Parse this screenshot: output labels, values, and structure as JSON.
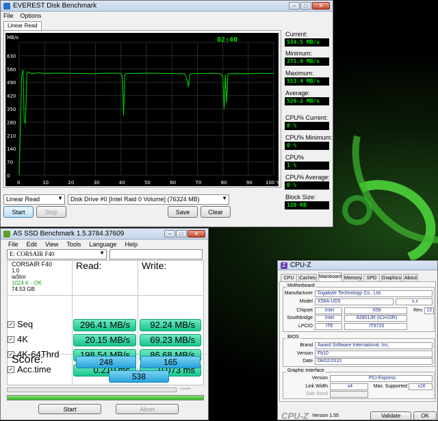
{
  "everest": {
    "title": "EVEREST Disk Benchmark",
    "menu": [
      "File",
      "Options"
    ],
    "tab": "Linear Read",
    "timer": "02:40",
    "y_unit": "MB/s",
    "side": [
      {
        "label": "Current:",
        "value": "534.5 MB/s"
      },
      {
        "label": "Minimum:",
        "value": "271.9 MB/s"
      },
      {
        "label": "Maximum:",
        "value": "553.4 MB/s"
      },
      {
        "label": "Average:",
        "value": "526.2 MB/s"
      },
      {
        "label": "CPU% Current:",
        "value": "0 %"
      },
      {
        "label": "CPU% Minimum:",
        "value": "0 %"
      },
      {
        "label": "CPU% Maximum:",
        "value": "1 %"
      },
      {
        "label": "CPU% Average:",
        "value": "0 %"
      },
      {
        "label": "Block Size:",
        "value": "128 KB"
      }
    ],
    "test_select": "Linear Read",
    "drive_select": "Disk Drive #0  [Intel  Raid 0 Volume]  (76324 MB)",
    "buttons": {
      "start": "Start",
      "stop": "Stop",
      "save": "Save",
      "clear": "Clear"
    },
    "colors": {
      "plot_bg": "#000000",
      "line": "#00c000",
      "grid": "#2a2a2a"
    }
  },
  "chart_data": {
    "type": "line",
    "x_unit": "%",
    "ylabel": "MB/s",
    "xlim": [
      0,
      100
    ],
    "ylim": [
      0,
      700
    ],
    "x_ticks": [
      "0",
      "10",
      "20",
      "30",
      "40",
      "50",
      "60",
      "70",
      "80",
      "90",
      "100 %"
    ],
    "y_ticks": [
      "700",
      "630",
      "560",
      "490",
      "420",
      "350",
      "280",
      "210",
      "140",
      "70",
      "0"
    ],
    "series": [
      {
        "x": [
          0,
          1,
          1.5,
          2,
          2.5,
          3,
          3.5,
          4,
          5,
          6,
          8,
          10,
          15,
          20,
          25,
          30,
          35,
          40,
          40.5,
          41,
          41.5,
          42,
          45,
          50,
          55,
          60,
          65,
          66,
          66.5,
          67,
          67.5,
          68,
          70,
          75,
          79,
          80,
          80.5,
          81,
          81.5,
          82,
          85,
          90,
          95,
          100
        ],
        "y": [
          0,
          530,
          555,
          285,
          275,
          535,
          545,
          540,
          535,
          538,
          540,
          536,
          538,
          537,
          536,
          535,
          538,
          537,
          520,
          315,
          530,
          537,
          536,
          538,
          537,
          536,
          535,
          500,
          465,
          530,
          536,
          535,
          536,
          537,
          535,
          520,
          350,
          530,
          380,
          535,
          536,
          535,
          537,
          536
        ]
      }
    ]
  },
  "ssd": {
    "title": "AS SSD Benchmark 1.5.3784.37609",
    "menu": [
      "File",
      "Edit",
      "View",
      "Tools",
      "Language",
      "Help"
    ],
    "drive_select": "E: CORSAIR F40",
    "info": [
      "CORSAIR F40",
      "1.0",
      "iaStor",
      "1024 K - OK",
      "74.53 GB"
    ],
    "read_header": "Read:",
    "write_header": "Write:",
    "rows": [
      {
        "label": "Seq",
        "read": "296.41 MB/s",
        "write": "92.24 MB/s"
      },
      {
        "label": "4K",
        "read": "20.15 MB/s",
        "write": "69.23 MB/s"
      },
      {
        "label": "4K-64Thrd",
        "read": "198.54 MB/s",
        "write": "86.68 MB/s"
      },
      {
        "label": "Acc.time",
        "read": "0.210 ms",
        "write": "0.073 ms"
      }
    ],
    "score_label": "Score:",
    "score_read": "248",
    "score_write": "165",
    "score_total": "538",
    "progress_text": "-:--:--",
    "progress": 1.0,
    "buttons": {
      "start": "Start",
      "abort": "Abort"
    }
  },
  "cpuz": {
    "title": "CPU-Z",
    "tabs": [
      "CPU",
      "Caches",
      "Mainboard",
      "Memory",
      "SPD",
      "Graphics",
      "About"
    ],
    "active_tab": "Mainboard",
    "motherboard_title": "Motherboard",
    "manufacturer_label": "Manufacturer",
    "manufacturer": "Gigabyte Technology Co., Ltd.",
    "model_label": "Model",
    "model": "X58A-UD5",
    "model_rev": "x.x",
    "chipset_label": "Chipset",
    "chipset_vendor": "Intel",
    "chipset": "X58",
    "rev_label": "Rev.",
    "rev": "13",
    "southbridge_label": "Southbridge",
    "sb_vendor": "Intel",
    "sb": "82801JR (ICH10R)",
    "lpcio_label": "LPCIO",
    "lpcio_vendor": "ITE",
    "lpcio": "IT8720",
    "bios_title": "BIOS",
    "brand_label": "Brand",
    "brand": "Award Software International, Inc.",
    "version_label": "Version",
    "version": "Fb10",
    "date_label": "Date",
    "date": "08/02/2010",
    "graphic_title": "Graphic Interface",
    "gi_version_label": "Version",
    "gi_version": "PCI-Express",
    "linkwidth_label": "Link Width",
    "linkwidth": "x4",
    "maxsupported_label": "Max. Supported",
    "maxsupported": "x16",
    "sideband_label": "Side Band",
    "footer_logo": "CPU-Z",
    "footer_version": "Version 1.55",
    "validate": "Validate",
    "ok": "OK"
  }
}
